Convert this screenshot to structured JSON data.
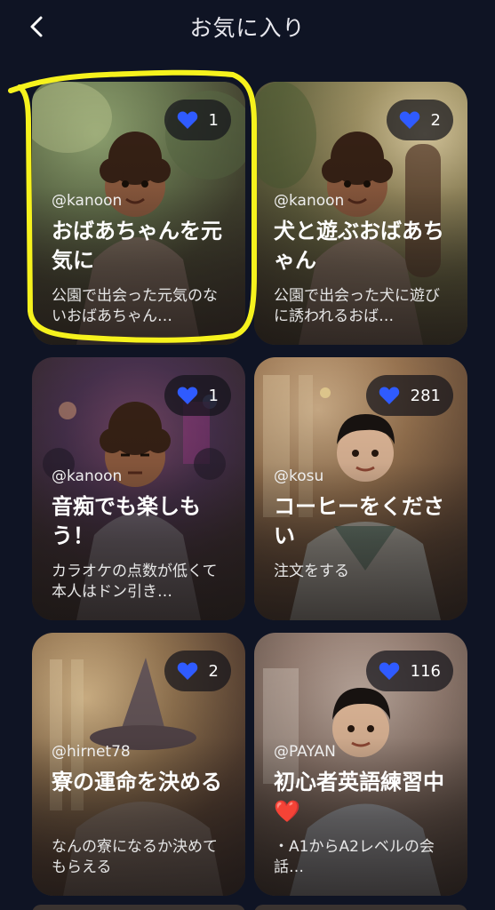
{
  "header": {
    "title": "お気に入り",
    "back_icon": "chevron-left-icon"
  },
  "colors": {
    "background": "#0f1424",
    "heart": "#2f5bff",
    "highlight": "#f6f21d",
    "emoji_heart": "#e8242c"
  },
  "cards": [
    {
      "author": "@kanoon",
      "title": "おばあちゃんを元気に",
      "description": "公園で出会った元気のないおばあちゃん…",
      "likes": "1"
    },
    {
      "author": "@kanoon",
      "title": "犬と遊ぶおばあちゃん",
      "description": "公園で出会った犬に遊びに誘われるおば…",
      "likes": "2"
    },
    {
      "author": "@kanoon",
      "title": "音痴でも楽しもう！",
      "description": "カラオケの点数が低くて本人はドン引き…",
      "likes": "1"
    },
    {
      "author": "@kosu",
      "title": "コーヒーをください",
      "description": "注文をする",
      "likes": "281"
    },
    {
      "author": "@hirnet78",
      "title": "寮の運命を決める",
      "description": "なんの寮になるか決めてもらえる",
      "likes": "2"
    },
    {
      "author": "@PAYAN",
      "title": "初心者英語練習中",
      "title_emoji": "❤️",
      "description": "・A1からA2レベルの会話…",
      "likes": "116"
    }
  ]
}
